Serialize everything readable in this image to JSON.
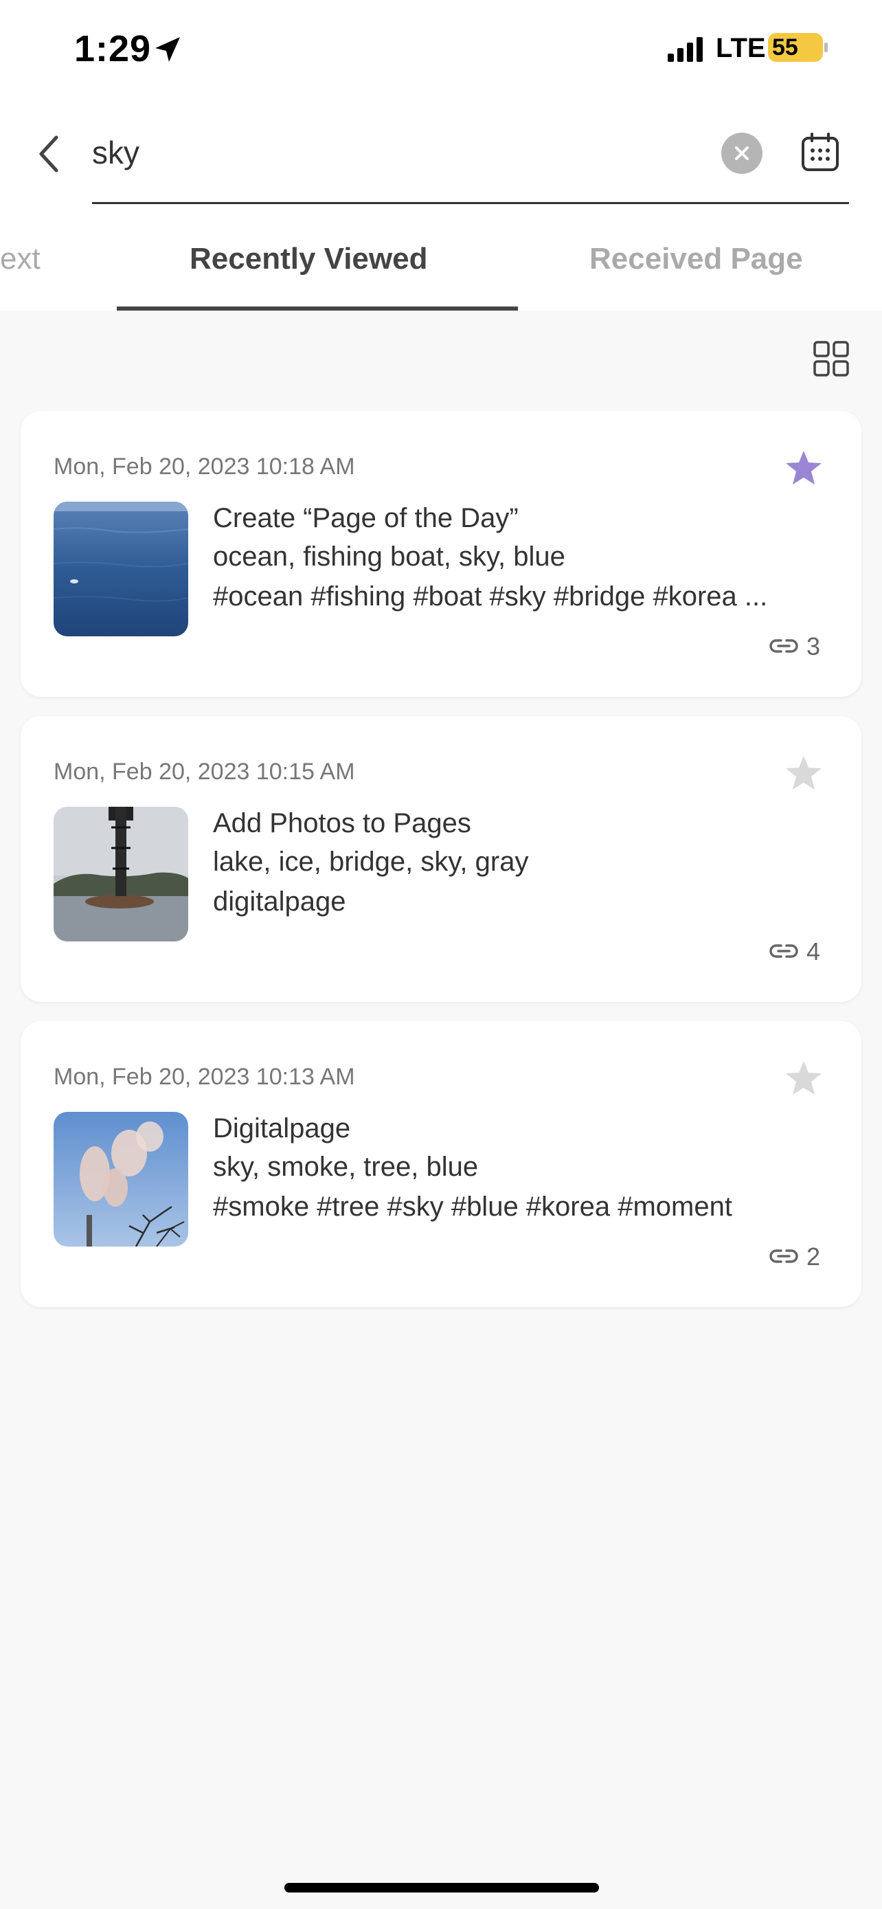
{
  "status_bar": {
    "time": "1:29",
    "network": "LTE",
    "battery": "55"
  },
  "search": {
    "query": "sky"
  },
  "tabs": [
    {
      "label": "ext"
    },
    {
      "label": "Recently Viewed"
    },
    {
      "label": "Received Page"
    }
  ],
  "colors": {
    "accent_star": "#9a86d4",
    "inactive_star": "#d9d9d9",
    "battery": "#f5c842"
  },
  "cards": [
    {
      "date": "Mon, Feb 20, 2023 10:18 AM",
      "favorite": true,
      "title": "Create “Page of the Day”",
      "keywords": "ocean, fishing boat, sky, blue",
      "tags": "#ocean #fishing #boat #sky #bridge #korea ...",
      "link_count": "3"
    },
    {
      "date": "Mon, Feb 20, 2023 10:15 AM",
      "favorite": false,
      "title": "Add Photos to Pages",
      "keywords": "lake, ice, bridge, sky, gray",
      "tags": "digitalpage",
      "link_count": "4"
    },
    {
      "date": "Mon, Feb 20, 2023 10:13 AM",
      "favorite": false,
      "title": "Digitalpage",
      "keywords": "sky, smoke, tree, blue",
      "tags": "#smoke #tree #sky #blue #korea #moment",
      "link_count": "2"
    }
  ]
}
